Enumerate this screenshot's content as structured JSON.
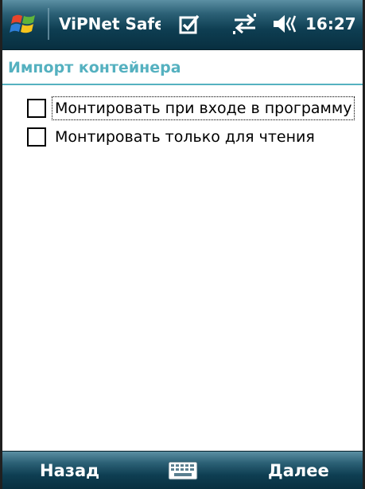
{
  "status_bar": {
    "app_title": "ViPNet SafeDisk",
    "time": "16:27",
    "icons": [
      "windows-start-icon",
      "edit-check-icon",
      "connectivity-icon",
      "speaker-icon"
    ]
  },
  "page": {
    "title": "Импорт контейнера"
  },
  "options": [
    {
      "label": "Монтировать при входе в программу",
      "checked": false,
      "focused": true
    },
    {
      "label": "Монтировать только для чтения",
      "checked": false,
      "focused": false
    }
  ],
  "softkeys": {
    "left": "Назад",
    "right": "Далее",
    "center_icon": "keyboard-icon"
  },
  "colors": {
    "bar_dark": "#0e3e52",
    "bar_light": "#5b8fa3",
    "accent": "#55b1c0"
  }
}
